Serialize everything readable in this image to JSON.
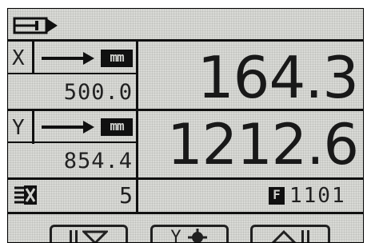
{
  "header": {
    "icon": "program-select-icon"
  },
  "axes": [
    {
      "label": "X",
      "unit": "mm",
      "feed": "500.0",
      "position": "164.3",
      "arrow_icon": "arrow-right-icon"
    },
    {
      "label": "Y",
      "unit": "mm",
      "feed": "854.4",
      "position": "1212.6",
      "arrow_icon": "arrow-right-icon"
    }
  ],
  "status": {
    "counter_icon": "piece-counter-icon",
    "counter": "5",
    "program_badge": "F",
    "program": "1101"
  },
  "softkeys": [
    {
      "icon": "arrow-down-icon"
    },
    {
      "label": "Y",
      "icon": "crosshair-icon"
    },
    {
      "icon": "arrow-up-icon"
    }
  ]
}
